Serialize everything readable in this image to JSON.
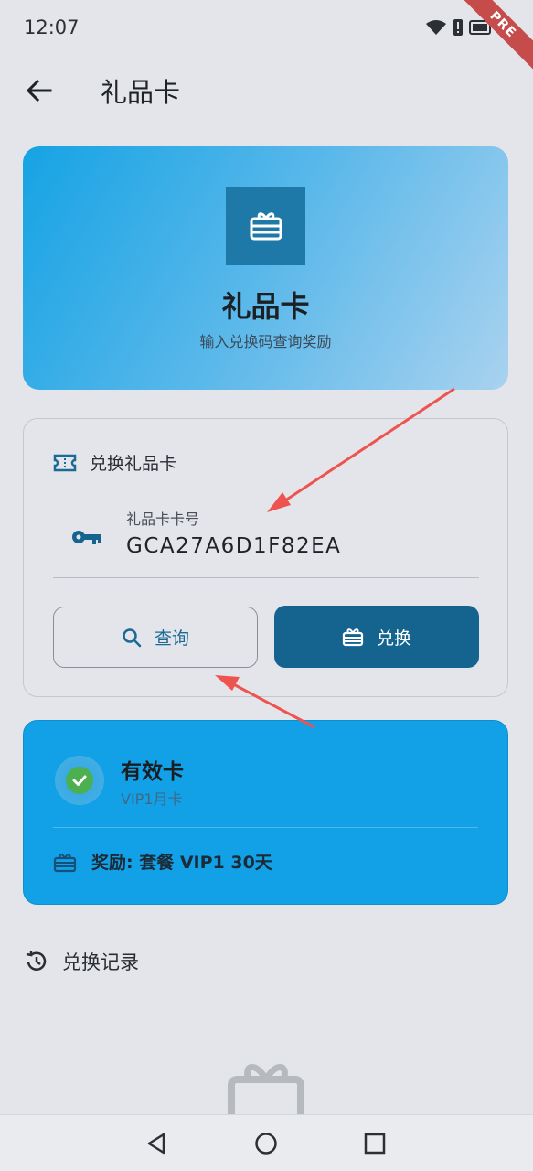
{
  "status_bar": {
    "time": "12:07",
    "badge": "PRE"
  },
  "app_bar": {
    "title": "礼品卡"
  },
  "hero": {
    "title": "礼品卡",
    "subtitle": "输入兑换码查询奖励"
  },
  "redeem": {
    "section_title": "兑换礼品卡",
    "field_label": "礼品卡卡号",
    "field_value": "GCA27A6D1F82EA",
    "query_label": "查询",
    "redeem_label": "兑换"
  },
  "result": {
    "title": "有效卡",
    "subtitle": "VIP1月卡",
    "reward": "奖励: 套餐 VIP1 30天"
  },
  "history": {
    "title": "兑换记录"
  },
  "colors": {
    "primary": "#15648f",
    "accent": "#12a0e6",
    "success": "#4caf50",
    "annotation_arrow": "#ef5350"
  }
}
